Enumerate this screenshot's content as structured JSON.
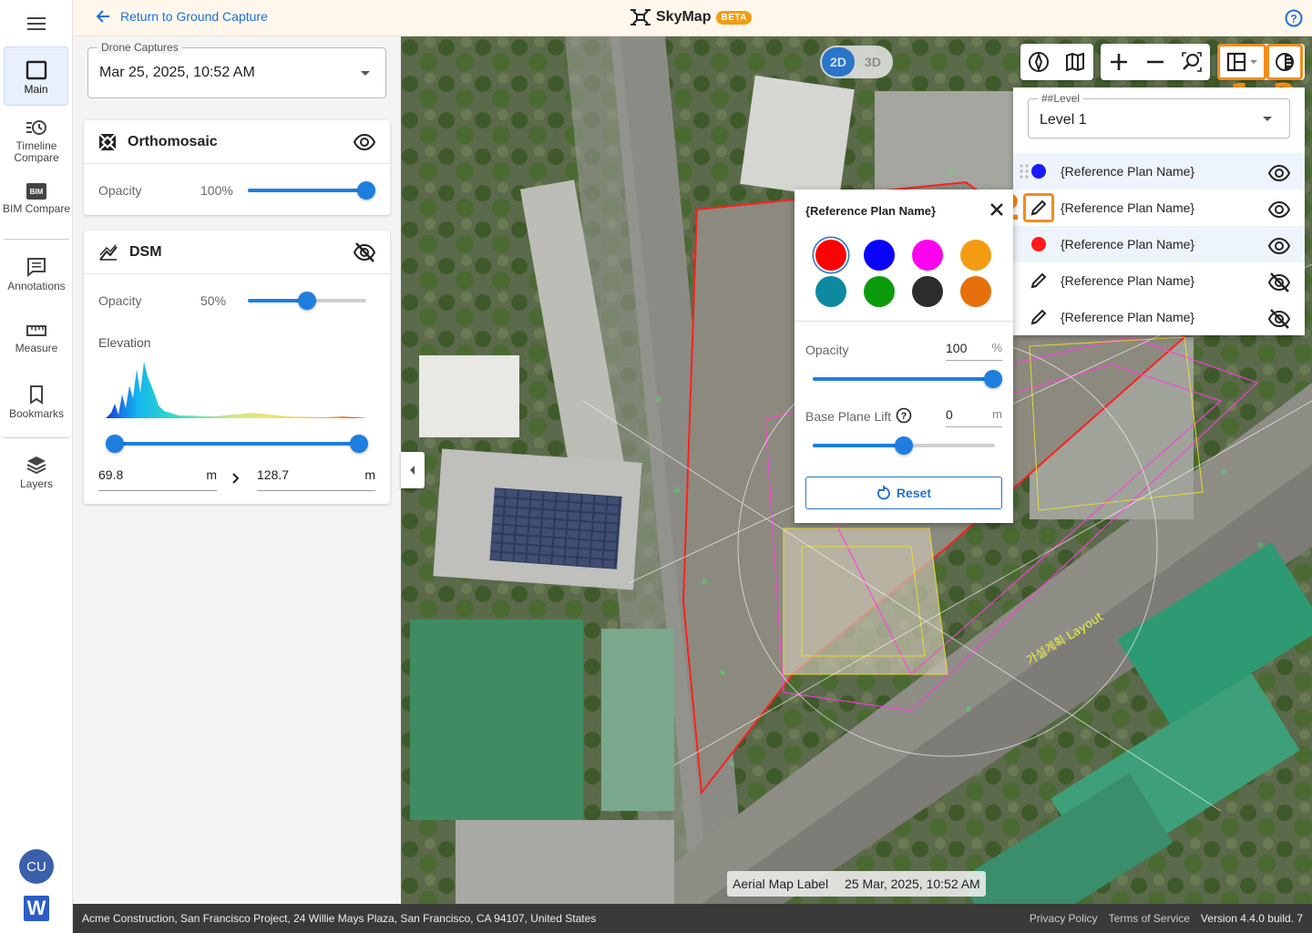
{
  "header": {
    "back_label": "Return to Ground Capture",
    "app_name": "SkyMap",
    "beta_badge": "BETA"
  },
  "rail": {
    "items": [
      {
        "label": "Main",
        "icon": "square-icon"
      },
      {
        "label": "Timeline Compare",
        "icon": "timeline-icon"
      },
      {
        "label": "BIM Compare",
        "icon": "bim-icon",
        "badge": "BIM"
      },
      {
        "label": "Annotations",
        "icon": "annotations-icon"
      },
      {
        "label": "Measure",
        "icon": "ruler-icon"
      },
      {
        "label": "Bookmarks",
        "icon": "bookmark-icon"
      },
      {
        "label": "Layers",
        "icon": "layers-icon"
      }
    ],
    "avatar_initials": "CU",
    "logo_letter": "W"
  },
  "panel": {
    "capture_label": "Drone Captures",
    "capture_value": "Mar 25, 2025, 10:52 AM",
    "orthomosaic": {
      "title": "Orthomosaic",
      "opacity_label": "Opacity",
      "opacity_text": "100%",
      "opacity": 1.0,
      "visible": true
    },
    "dsm": {
      "title": "DSM",
      "opacity_label": "Opacity",
      "opacity_text": "50%",
      "opacity": 0.5,
      "visible": false,
      "elevation_label": "Elevation",
      "min": "69.8",
      "max": "128.7",
      "unit": "m"
    }
  },
  "map": {
    "mode_2d": "2D",
    "mode_3d": "3D",
    "active_mode": "2D",
    "level_label": "##Level",
    "level_value": "Level 1",
    "layers": [
      {
        "name": "{Reference Plan Name}",
        "icon": "dot",
        "color": "#1a1aff",
        "visible": true,
        "selected": true
      },
      {
        "name": "{Reference Plan Name}",
        "icon": "pencil",
        "visible": true,
        "selected": false
      },
      {
        "name": "{Reference Plan Name}",
        "icon": "dot",
        "color": "#ff1a1a",
        "visible": true,
        "selected": true
      },
      {
        "name": "{Reference Plan Name}",
        "icon": "pencil",
        "visible": false,
        "selected": false
      },
      {
        "name": "{Reference Plan Name}",
        "icon": "pencil",
        "visible": false,
        "selected": false
      }
    ],
    "annotations": [
      "1",
      "2",
      "3"
    ],
    "aerial_label": "Aerial Map Label",
    "aerial_date": "25 Mar, 2025, 10:52 AM",
    "overlay_text": "가설계획 Layout"
  },
  "popup": {
    "title": "{Reference Plan Name}",
    "colors": [
      "#ff0000",
      "#0a00ff",
      "#ff00ee",
      "#f39c12",
      "#0e8aa0",
      "#0a9a0a",
      "#2c2c2c",
      "#e8700a"
    ],
    "selected_color": "#ff0000",
    "opacity_label": "Opacity",
    "opacity_value": "100",
    "opacity_unit": "%",
    "opacity": 1.0,
    "lift_label": "Base Plane Lift",
    "lift_value": "0",
    "lift_unit": "m",
    "lift_fraction": 0.5,
    "reset_label": "Reset"
  },
  "footer": {
    "address": "Acme Construction, San Francisco Project, 24 Willie Mays Plaza, San Francisco, CA 94107, United States",
    "privacy": "Privacy Policy",
    "terms": "Terms of Service",
    "version": "Version 4.4.0 build. 7"
  }
}
